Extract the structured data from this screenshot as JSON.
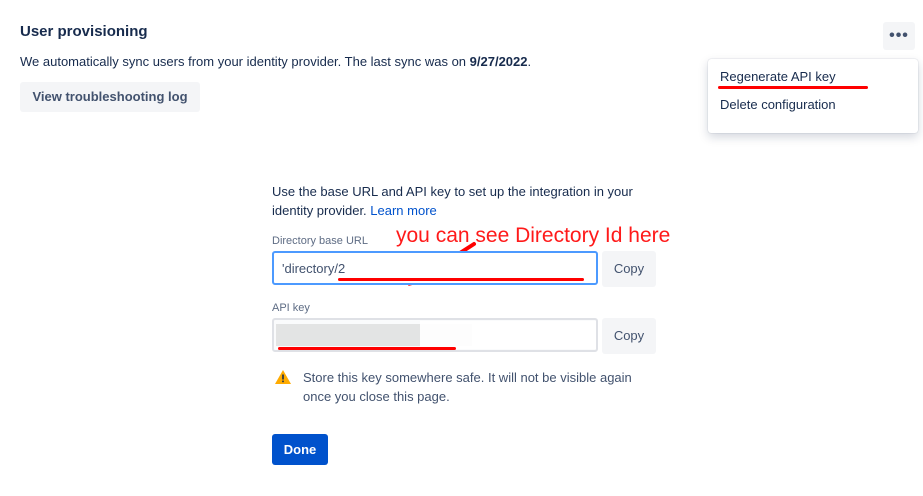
{
  "header": {
    "title": "User provisioning",
    "description_prefix": "We automatically sync users from your identity provider. The last sync was on ",
    "last_sync_date": "9/27/2022",
    "description_suffix": ".",
    "troubleshoot_label": "View troubleshooting log",
    "more_label": "•••"
  },
  "menu": {
    "items": [
      {
        "label": "Regenerate API key"
      },
      {
        "label": "Delete configuration"
      }
    ]
  },
  "setup": {
    "intro_text": "Use the base URL and API key to set up the integration in your identity provider. ",
    "learn_more": "Learn more",
    "annotation": "you can see Directory Id here",
    "directory_url": {
      "label": "Directory base URL",
      "value": "'directory/2",
      "copy_label": "Copy"
    },
    "api_key": {
      "label": "API key",
      "value": "",
      "copy_label": "Copy"
    },
    "warning": "Store this key somewhere safe. It will not be visible again once you close this page.",
    "done_label": "Done"
  },
  "colors": {
    "primary": "#0052cc",
    "annotation_red": "#ff0000",
    "warning_yellow": "#ffab00",
    "focus_border": "#4c9aff"
  }
}
